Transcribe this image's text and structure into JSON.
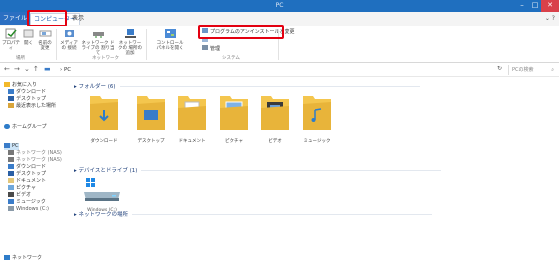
{
  "window": {
    "title": "PC"
  },
  "ribbon_tabs": {
    "file": "ファイル",
    "computer": "コンピューター",
    "view": "表示"
  },
  "ribbon": {
    "buttons": [
      {
        "label": "プロパティ"
      },
      {
        "label": "開く"
      },
      {
        "label": "名前の\n変更"
      },
      {
        "label": "メディアの\n接続"
      },
      {
        "label": "ネットワーク ドライブの\n割り当て"
      },
      {
        "label": "ネットワークの\n場所の追加"
      },
      {
        "label": "コントロール\nパネルを開く"
      }
    ],
    "system_items": {
      "uninstall": "プログラムのアンインストールと変更",
      "system_props": "",
      "manage": "管理"
    },
    "groups": {
      "location": "場所",
      "network": "ネットワーク",
      "system": "システム"
    }
  },
  "address": {
    "path": "PC",
    "search_placeholder": "PCの検索"
  },
  "sidebar": {
    "items": [
      {
        "label": "お気に入り"
      },
      {
        "label": "ダウンロード"
      },
      {
        "label": "デスクトップ"
      },
      {
        "label": "最近表示した場所"
      },
      {
        "label": "ホームグループ"
      },
      {
        "label": "PC"
      },
      {
        "label": "ネットワーク (NAS)"
      },
      {
        "label": "ネットワーク (NAS)"
      },
      {
        "label": "ダウンロード"
      },
      {
        "label": "デスクトップ"
      },
      {
        "label": "ドキュメント"
      },
      {
        "label": "ピクチャ"
      },
      {
        "label": "ビデオ"
      },
      {
        "label": "ミュージック"
      },
      {
        "label": "Windows (C:)"
      },
      {
        "label": "ネットワーク"
      }
    ]
  },
  "content": {
    "folders_header": "フォルダー (6)",
    "folders": [
      {
        "label": "ダウンロード"
      },
      {
        "label": "デスクトップ"
      },
      {
        "label": "ドキュメント"
      },
      {
        "label": "ピクチャ"
      },
      {
        "label": "ビデオ"
      },
      {
        "label": "ミュージック"
      }
    ],
    "devices_header": "デバイスとドライブ (1)",
    "drive_label": "Windows (C:)",
    "network_header": "ネットワークの場所"
  },
  "colors": {
    "accent": "#2b6fc2",
    "highlight": "#e30010",
    "folder": "#f4c64e"
  }
}
